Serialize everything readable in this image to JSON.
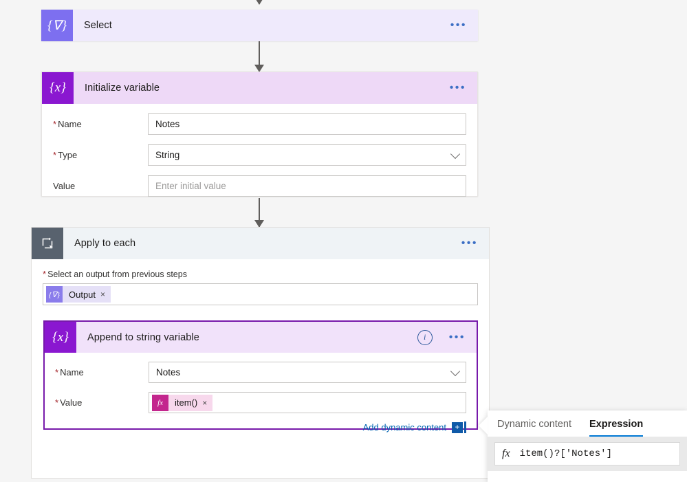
{
  "canvas": {
    "background": "#f5f5f5"
  },
  "steps": {
    "select": {
      "title": "Select",
      "icon": "select-braces-icon",
      "icon_glyph": "{∇}",
      "icon_color": "#7d6ff0",
      "header_color": "#efeafc",
      "more_label": "•••"
    },
    "initialize_variable": {
      "title": "Initialize variable",
      "icon": "variable-braces-icon",
      "icon_glyph": "{x}",
      "icon_color": "#8a17d0",
      "header_color": "#eed9f7",
      "more_label": "•••",
      "fields": [
        {
          "label": "Name",
          "required": true,
          "value": "Notes",
          "placeholder": "",
          "type": "text"
        },
        {
          "label": "Type",
          "required": true,
          "value": "String",
          "placeholder": "",
          "type": "dropdown"
        },
        {
          "label": "Value",
          "required": false,
          "value": "",
          "placeholder": "Enter initial value",
          "type": "text"
        }
      ]
    },
    "apply_to_each": {
      "title": "Apply to each",
      "icon": "loop-arrow-icon",
      "icon_color": "#58626e",
      "header_color": "#eff3f6",
      "more_label": "•••",
      "output_label": "Select an output from previous steps",
      "output_required": true,
      "token": {
        "text": "Output",
        "icon": "select-braces-icon",
        "icon_glyph": "{∇}",
        "remove_label": "×"
      }
    },
    "append_to_string_variable": {
      "title": "Append to string variable",
      "icon": "variable-braces-icon",
      "icon_glyph": "{x}",
      "icon_color": "#8a17d0",
      "header_color": "#f1e2fa",
      "selected_border_color": "#7719aa",
      "info_label": "i",
      "more_label": "•••",
      "fields": [
        {
          "label": "Name",
          "required": true,
          "value": "Notes",
          "type": "dropdown"
        },
        {
          "label": "Value",
          "required": true,
          "value": "",
          "type": "token"
        }
      ],
      "value_token": {
        "text": "item()",
        "icon": "fx-icon",
        "icon_glyph": "fx",
        "remove_label": "×"
      },
      "add_dynamic_content": {
        "label": "Add dynamic content",
        "plus_label": "+",
        "color": "#0063b1"
      }
    }
  },
  "expression_flyout": {
    "tabs": [
      {
        "label": "Dynamic content",
        "active": false
      },
      {
        "label": "Expression",
        "active": true
      }
    ],
    "editor": {
      "fx_glyph": "fx",
      "value": "item()?['Notes']"
    },
    "accent_color": "#0078d4"
  }
}
